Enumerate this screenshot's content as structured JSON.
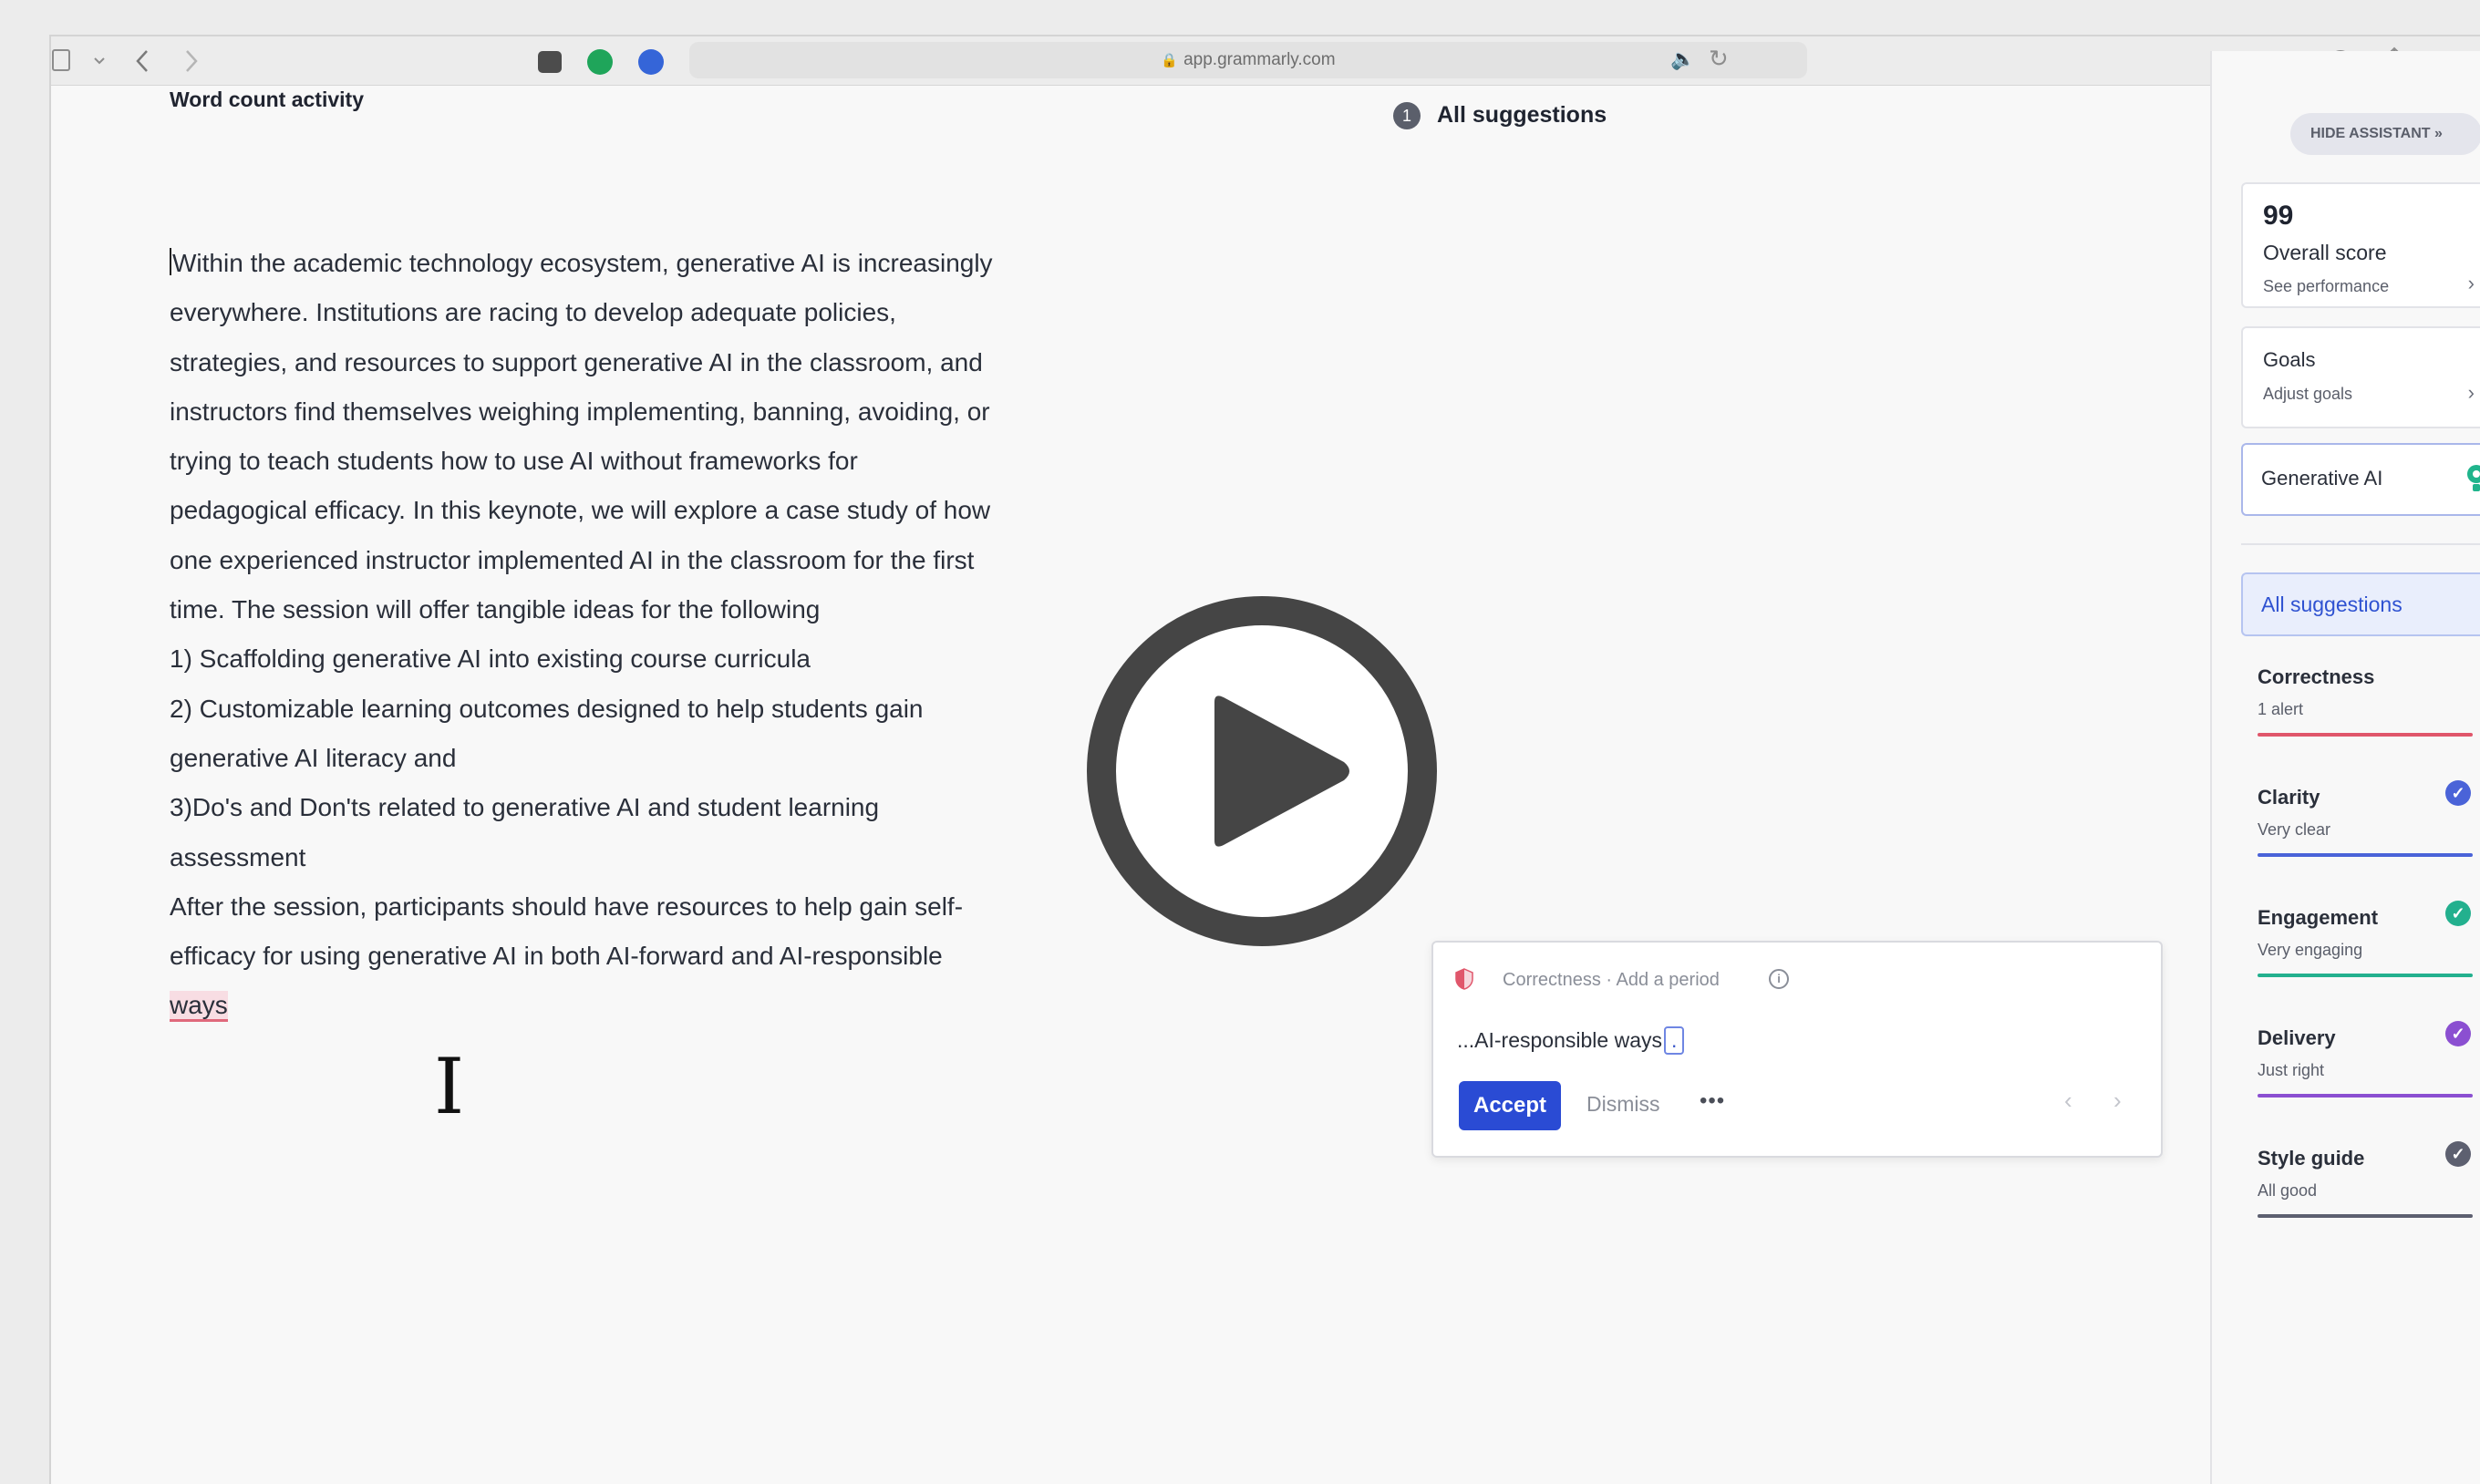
{
  "browser": {
    "url": "app.grammarly.com",
    "back_icon": "chevron-left-icon",
    "forward_icon": "chevron-right-icon"
  },
  "editor": {
    "title": "Word count activity",
    "lines": [
      "Within the academic technology ecosystem, generative AI is increasingly",
      "everywhere. Institutions are racing to develop adequate policies,",
      "strategies, and resources to support generative AI in the classroom, and",
      "instructors find themselves weighing implementing, banning, avoiding, or",
      "trying to teach students how to use AI without frameworks for",
      "pedagogical efficacy. In this keynote, we will explore a case study of how",
      "one experienced instructor implemented AI in the classroom for the first",
      "time. The session will offer tangible ideas for the following",
      "1) Scaffolding generative AI into existing course curricula",
      "2) Customizable learning outcomes designed to help students gain",
      "generative AI literacy and",
      "3)Do's and Don'ts related to generative AI and student learning",
      "assessment",
      "After the session, participants should have resources to help gain self-",
      "efficacy for using generative AI in both AI-forward and AI-responsible"
    ],
    "flagged_word": "ways"
  },
  "suggestions_header": {
    "count": "1",
    "title": "All suggestions"
  },
  "suggestion_card": {
    "category": "Correctness · Add a period",
    "preview_prefix": "...AI-responsible ways",
    "preview_insert": ".",
    "accept_label": "Accept",
    "dismiss_label": "Dismiss",
    "more_label": "•••"
  },
  "assistant": {
    "hide_label": "HIDE ASSISTANT »",
    "score": {
      "value": "99",
      "label": "Overall score",
      "link": "See performance"
    },
    "goals": {
      "title": "Goals",
      "link": "Adjust goals"
    },
    "generative_ai_label": "Generative AI",
    "all_suggestions_label": "All suggestions",
    "categories": [
      {
        "name": "Correctness",
        "status": "1 alert",
        "color": "#e0566b",
        "checked": false
      },
      {
        "name": "Clarity",
        "status": "Very clear",
        "color": "#4a63d8",
        "checked": true
      },
      {
        "name": "Engagement",
        "status": "Very engaging",
        "color": "#23b08e",
        "checked": true
      },
      {
        "name": "Delivery",
        "status": "Just right",
        "color": "#8b4fd1",
        "checked": true
      },
      {
        "name": "Style guide",
        "status": "All good",
        "color": "#5d6070",
        "checked": true
      }
    ]
  },
  "colors": {
    "accent": "#2a4bd4",
    "correctness": "#e0566b",
    "clarity": "#4a63d8",
    "engagement": "#23b08e",
    "delivery": "#8b4fd1",
    "style_guide": "#5d6070"
  },
  "overlay": {
    "play_icon": "play-icon"
  }
}
